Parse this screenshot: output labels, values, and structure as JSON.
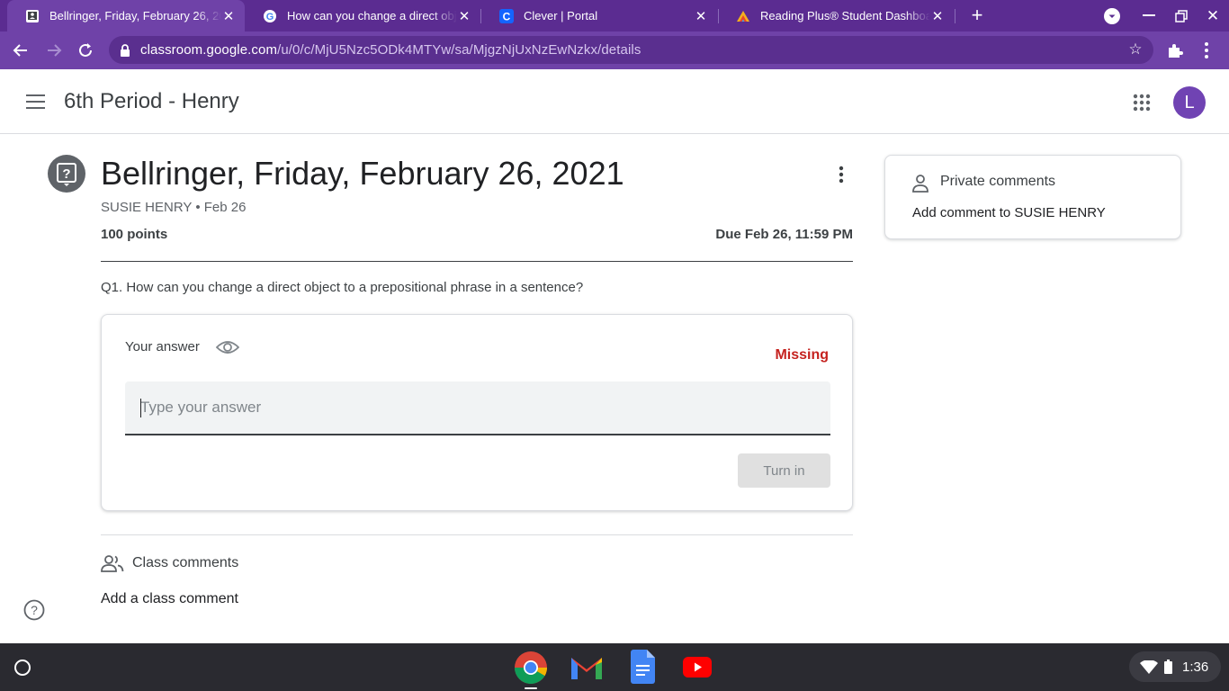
{
  "browser": {
    "tabs": [
      {
        "title": "Bellringer, Friday, February 26, 2021",
        "active": true
      },
      {
        "title": "How can you change a direct object",
        "active": false
      },
      {
        "title": "Clever | Portal",
        "active": false
      },
      {
        "title": "Reading Plus® Student Dashboard",
        "active": false
      }
    ],
    "url_host": "classroom.google.com",
    "url_path": "/u/0/c/MjU5Nzc5ODk4MTYw/sa/MjgzNjUxNzEwNzkx/details"
  },
  "header": {
    "class_name": "6th Period - Henry",
    "avatar_letter": "L"
  },
  "assignment": {
    "title": "Bellringer, Friday, February 26, 2021",
    "author": "SUSIE HENRY",
    "date": "Feb 26",
    "points": "100 points",
    "due": "Due Feb 26, 11:59 PM",
    "question": "Q1. How can you change a direct object to a prepositional phrase in a sentence?"
  },
  "answer_card": {
    "label": "Your answer",
    "status": "Missing",
    "placeholder": "Type your answer",
    "turn_in_label": "Turn in"
  },
  "comments": {
    "class_label": "Class comments",
    "add_class": "Add a class comment"
  },
  "private_comments": {
    "title": "Private comments",
    "add": "Add comment to SUSIE HENRY"
  },
  "shelf": {
    "time": "1:36",
    "apps": [
      "chrome-icon",
      "gmail-icon",
      "docs-icon",
      "youtube-icon"
    ]
  },
  "colors": {
    "frame": "#5b2c91",
    "toolbar": "#6f42a8",
    "missing": "#c5221f",
    "avatar": "#7043b3"
  }
}
